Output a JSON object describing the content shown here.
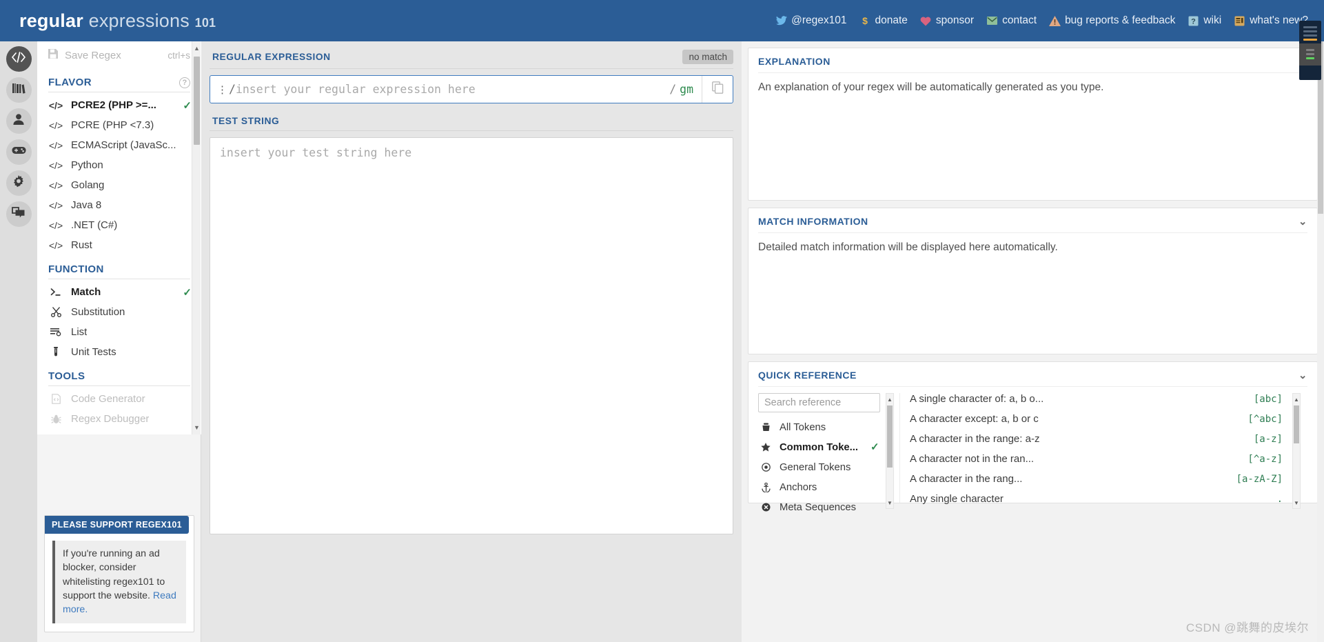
{
  "header": {
    "brand_bold": "regular",
    "brand_light": "expressions",
    "brand_num": "101",
    "nav": [
      {
        "icon": "twitter-icon",
        "label": "@regex101"
      },
      {
        "icon": "dollar-icon",
        "label": "donate"
      },
      {
        "icon": "heart-icon",
        "label": "sponsor"
      },
      {
        "icon": "mail-icon",
        "label": "contact"
      },
      {
        "icon": "warning-icon",
        "label": "bug reports & feedback"
      },
      {
        "icon": "question-box-icon",
        "label": "wiki"
      },
      {
        "icon": "news-icon",
        "label": "what's new?"
      }
    ]
  },
  "rail": [
    {
      "icon": "code-icon",
      "name": "editor",
      "active": true
    },
    {
      "icon": "library-icon",
      "name": "library",
      "active": false
    },
    {
      "icon": "account-icon",
      "name": "account",
      "active": false
    },
    {
      "icon": "gamepad-icon",
      "name": "sponsor-game",
      "active": false
    },
    {
      "icon": "gear-icon",
      "name": "settings",
      "active": false
    },
    {
      "icon": "chat-icon",
      "name": "community",
      "active": false
    }
  ],
  "sidebar": {
    "save": {
      "label": "Save Regex",
      "shortcut": "ctrl+s",
      "icon": "save-icon"
    },
    "flavor_title": "FLAVOR",
    "flavor_help": "?",
    "flavors": [
      {
        "label": "PCRE2 (PHP >=...",
        "selected": true
      },
      {
        "label": "PCRE (PHP <7.3)",
        "selected": false
      },
      {
        "label": "ECMAScript (JavaSc...",
        "selected": false
      },
      {
        "label": "Python",
        "selected": false
      },
      {
        "label": "Golang",
        "selected": false
      },
      {
        "label": "Java 8",
        "selected": false
      },
      {
        "label": ".NET (C#)",
        "selected": false
      },
      {
        "label": "Rust",
        "selected": false
      }
    ],
    "function_title": "FUNCTION",
    "functions": [
      {
        "label": "Match",
        "icon": "prompt-icon",
        "selected": true
      },
      {
        "label": "Substitution",
        "icon": "scissors-icon",
        "selected": false
      },
      {
        "label": "List",
        "icon": "list-icon",
        "selected": false
      },
      {
        "label": "Unit Tests",
        "icon": "testtube-icon",
        "selected": false
      }
    ],
    "tools_title": "TOOLS",
    "tools": [
      {
        "label": "Code Generator",
        "icon": "code-file-icon",
        "disabled": true
      },
      {
        "label": "Regex Debugger",
        "icon": "bug-icon",
        "disabled": true
      }
    ],
    "support": {
      "title": "PLEASE SUPPORT REGEX101",
      "text": "If you're running an ad blocker, consider whitelisting regex101 to support the website. ",
      "link": "Read more."
    }
  },
  "main": {
    "regex_label": "REGULAR EXPRESSION",
    "match_badge": "no match",
    "regex_placeholder": "insert your regular expression here",
    "regex_value": "",
    "open_slash": "/",
    "close_slash": "/",
    "flag_g": "g",
    "flag_m": "m",
    "copy_icon": "copy-icon",
    "test_label": "TEST STRING",
    "test_placeholder": "insert your test string here",
    "test_value": ""
  },
  "right": {
    "explanation": {
      "title": "EXPLANATION",
      "text": "An explanation of your regex will be automatically generated as you type."
    },
    "match_info": {
      "title": "MATCH INFORMATION",
      "text": "Detailed match information will be displayed here automatically."
    },
    "quick_reference": {
      "title": "QUICK REFERENCE",
      "search_placeholder": "Search reference",
      "search_value": "",
      "categories": [
        {
          "label": "All Tokens",
          "icon": "tokens-icon",
          "selected": false
        },
        {
          "label": "Common Toke...",
          "icon": "star-icon",
          "selected": true
        },
        {
          "label": "General Tokens",
          "icon": "target-icon",
          "selected": false
        },
        {
          "label": "Anchors",
          "icon": "anchor-icon",
          "selected": false
        },
        {
          "label": "Meta Sequences",
          "icon": "meta-icon",
          "selected": false
        }
      ],
      "entries": [
        {
          "desc": "A single character of: a, b o...",
          "token": "[abc]"
        },
        {
          "desc": "A character except: a, b or c",
          "token": "[^abc]"
        },
        {
          "desc": "A character in the range: a-z",
          "token": "[a-z]"
        },
        {
          "desc": "A character not in the ran...",
          "token": "[^a-z]"
        },
        {
          "desc": "A character in the rang...",
          "token": "[a-zA-Z]"
        },
        {
          "desc": "Any single character",
          "token": "."
        }
      ]
    }
  },
  "watermark": "CSDN @跳舞的皮埃尔"
}
